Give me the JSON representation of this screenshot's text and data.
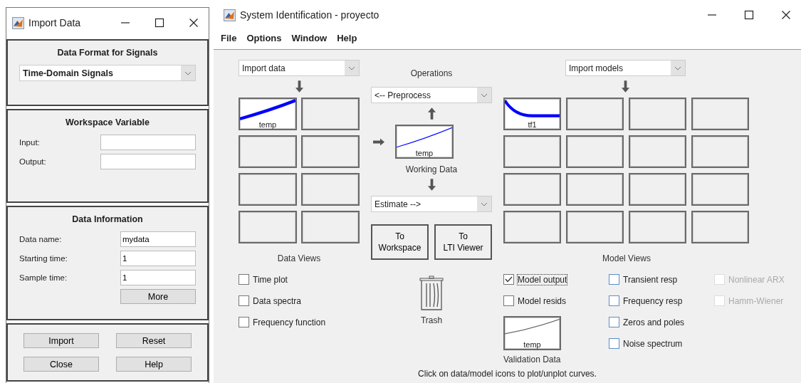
{
  "import_window": {
    "title": "Import Data",
    "format_section": {
      "heading": "Data Format for Signals",
      "dropdown": "Time-Domain Signals"
    },
    "workspace_section": {
      "heading": "Workspace Variable",
      "fields": [
        {
          "label": "Input:"
        },
        {
          "label": "Output:"
        }
      ]
    },
    "info_section": {
      "heading": "Data Information",
      "fields": [
        {
          "label": "Data name:",
          "value": "mydata"
        },
        {
          "label": "Starting time:",
          "value": "1"
        },
        {
          "label": "Sample time:",
          "value": "1"
        }
      ],
      "more_button": "More"
    },
    "buttons": [
      "Import",
      "Reset",
      "Close",
      "Help"
    ]
  },
  "ident_window": {
    "title": "System Identification - proyecto",
    "menu": [
      "File",
      "Options",
      "Window",
      "Help"
    ],
    "import_data_dropdown": "Import data",
    "data_slots": [
      {
        "label": "temp",
        "kind": "rising"
      },
      {
        "kind": "empty"
      },
      {
        "kind": "empty"
      },
      {
        "kind": "empty"
      },
      {
        "kind": "empty"
      },
      {
        "kind": "empty"
      },
      {
        "kind": "empty"
      },
      {
        "kind": "empty"
      }
    ],
    "data_views_label": "Data Views",
    "data_views": [
      {
        "label": "Time plot",
        "checked": false
      },
      {
        "label": "Data spectra",
        "checked": false
      },
      {
        "label": "Frequency function",
        "checked": false
      }
    ],
    "operations_label": "Operations",
    "preprocess_dropdown": "<-- Preprocess",
    "working_data": {
      "label": "temp",
      "caption": "Working Data"
    },
    "estimate_dropdown": "Estimate -->",
    "buttons": [
      [
        "To",
        "Workspace"
      ],
      [
        "To",
        "LTI Viewer"
      ]
    ],
    "trash_label": "Trash",
    "import_models_dropdown": "Import models",
    "model_slots": [
      {
        "label": "tf1",
        "kind": "decaying"
      },
      {
        "kind": "empty"
      },
      {
        "kind": "empty"
      },
      {
        "kind": "empty"
      },
      {
        "kind": "empty"
      },
      {
        "kind": "empty"
      },
      {
        "kind": "empty"
      },
      {
        "kind": "empty"
      },
      {
        "kind": "empty"
      },
      {
        "kind": "empty"
      },
      {
        "kind": "empty"
      },
      {
        "kind": "empty"
      },
      {
        "kind": "empty"
      },
      {
        "kind": "empty"
      },
      {
        "kind": "empty"
      },
      {
        "kind": "empty"
      }
    ],
    "model_views_label": "Model Views",
    "model_views": [
      [
        {
          "label": "Model output",
          "checked": true,
          "focused": true,
          "disabled": false
        },
        {
          "label": "Model resids",
          "checked": false,
          "focused": false,
          "disabled": false
        }
      ],
      [
        {
          "label": "Transient resp",
          "checked": false,
          "focused": false,
          "disabled": false
        },
        {
          "label": "Frequency resp",
          "checked": false,
          "focused": false,
          "disabled": false
        },
        {
          "label": "Zeros and poles",
          "checked": false,
          "focused": false,
          "disabled": false
        },
        {
          "label": "Noise spectrum",
          "checked": false,
          "focused": false,
          "disabled": false
        }
      ],
      [
        {
          "label": "Nonlinear ARX",
          "checked": false,
          "focused": false,
          "disabled": true
        },
        {
          "label": "Hamm-Wiener",
          "checked": false,
          "focused": false,
          "disabled": true
        }
      ]
    ],
    "validation_data": {
      "label": "temp",
      "caption": "Validation Data"
    },
    "footer": "Click on data/model icons to plot/unplot curves."
  }
}
